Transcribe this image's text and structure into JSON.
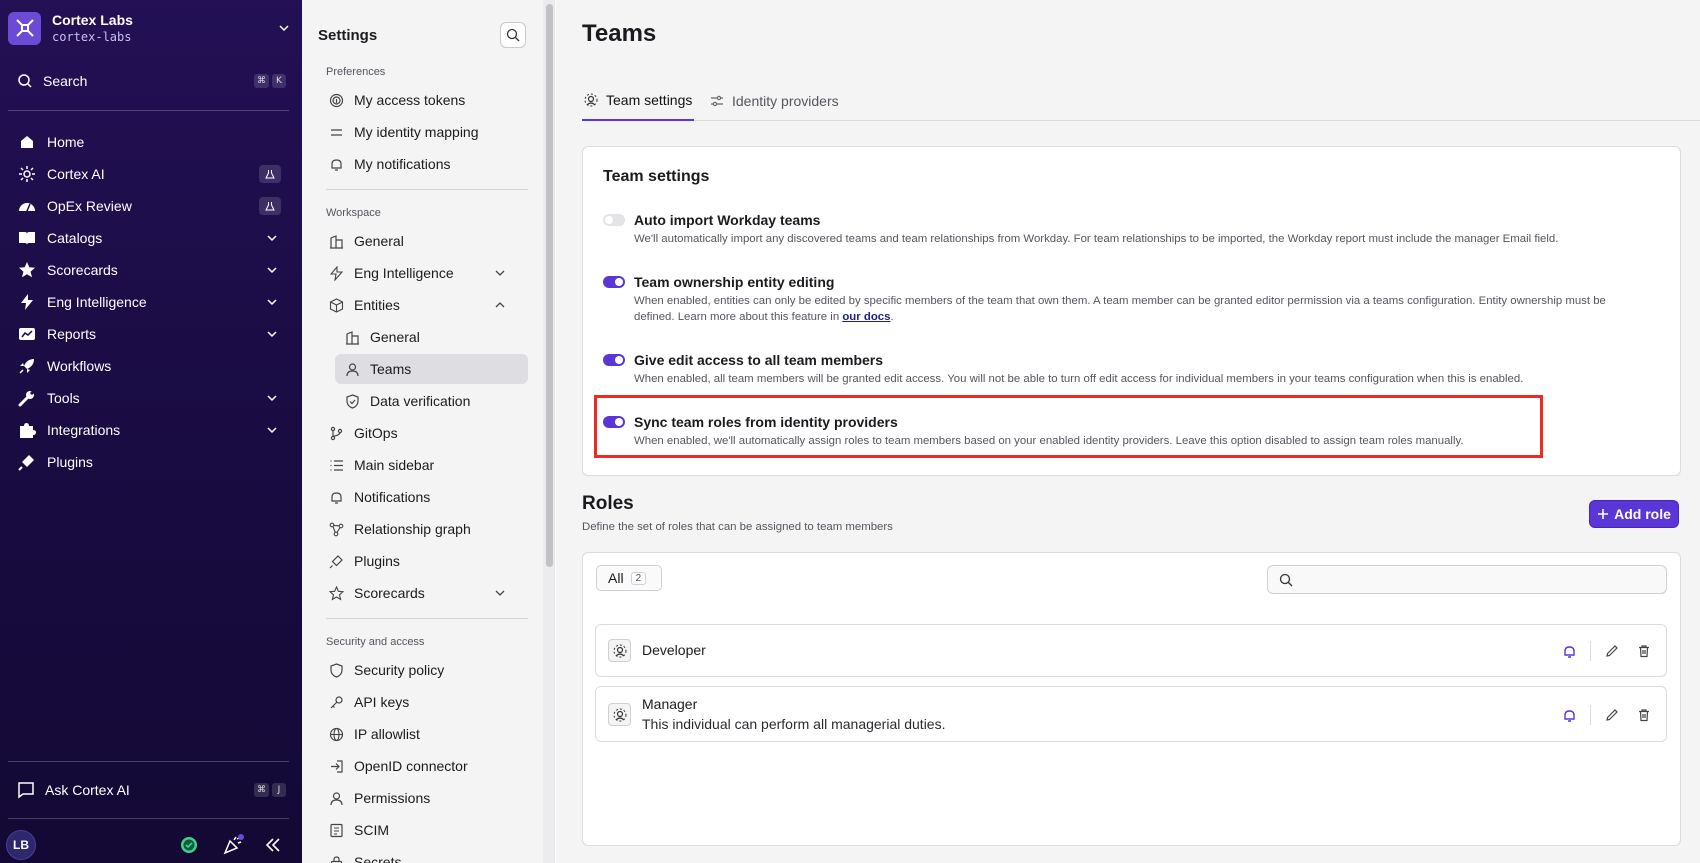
{
  "org": {
    "name": "Cortex Labs",
    "slug": "cortex-labs"
  },
  "nav": {
    "search_label": "Search",
    "search_keys": [
      "⌘",
      "K"
    ],
    "items": [
      {
        "label": "Home",
        "icon": "home-icon"
      },
      {
        "label": "Cortex AI",
        "icon": "sparkle-icon",
        "badge": "flask-icon"
      },
      {
        "label": "OpEx Review",
        "icon": "gauge-icon",
        "badge": "flask-icon"
      },
      {
        "label": "Catalogs",
        "icon": "book-icon",
        "chevron": true
      },
      {
        "label": "Scorecards",
        "icon": "star-icon",
        "chevron": true
      },
      {
        "label": "Eng Intelligence",
        "icon": "bolt-icon",
        "chevron": true
      },
      {
        "label": "Reports",
        "icon": "chart-icon",
        "chevron": true
      },
      {
        "label": "Workflows",
        "icon": "rocket-icon"
      },
      {
        "label": "Tools",
        "icon": "wrench-icon",
        "chevron": true
      },
      {
        "label": "Integrations",
        "icon": "puzzle-icon",
        "chevron": true
      },
      {
        "label": "Plugins",
        "icon": "plug-icon"
      }
    ],
    "ask_label": "Ask Cortex AI",
    "ask_keys": [
      "⌘",
      "J"
    ],
    "avatar_initials": "LB"
  },
  "settings": {
    "title": "Settings",
    "groups": {
      "preferences": "Preferences",
      "workspace": "Workspace",
      "security": "Security and access"
    },
    "preferences_items": [
      "My access tokens",
      "My identity mapping",
      "My notifications"
    ],
    "workspace_items": {
      "general": "General",
      "eng_intelligence": "Eng Intelligence",
      "entities": "Entities",
      "entities_general": "General",
      "teams": "Teams",
      "data_verification": "Data verification",
      "gitops": "GitOps",
      "main_sidebar": "Main sidebar",
      "notifications": "Notifications",
      "relationship_graph": "Relationship graph",
      "plugins": "Plugins",
      "scorecards": "Scorecards"
    },
    "security_items": [
      "Security policy",
      "API keys",
      "IP allowlist",
      "OpenID connector",
      "Permissions",
      "SCIM",
      "Secrets"
    ]
  },
  "page": {
    "title": "Teams",
    "tabs": {
      "team_settings": "Team settings",
      "identity_providers": "Identity providers"
    },
    "card_title": "Team settings",
    "settings": [
      {
        "title": "Auto import Workday teams",
        "on": false,
        "desc": "We'll automatically import any discovered teams and team relationships from Workday. For team relationships to be imported, the Workday report must include the manager Email field."
      },
      {
        "title": "Team ownership entity editing",
        "on": true,
        "desc": "When enabled, entities can only be edited by specific members of the team that own them. A team member can be granted editor permission via a teams configuration. Entity ownership must be defined. Learn more about this feature in ",
        "link": "our docs",
        "desc_end": "."
      },
      {
        "title": "Give edit access to all team members",
        "on": true,
        "desc": "When enabled, all team members will be granted edit access. You will not be able to turn off edit access for individual members in your teams configuration when this is enabled."
      },
      {
        "title": "Sync team roles from identity providers",
        "on": true,
        "desc": "When enabled, we'll automatically assign roles to team members based on your enabled identity providers. Leave this option disabled to assign team roles manually."
      }
    ],
    "roles": {
      "title": "Roles",
      "subtitle": "Define the set of roles that can be assigned to team members",
      "add_label": "Add role",
      "filter_label": "All",
      "filter_count": "2",
      "search_placeholder": "",
      "items": [
        {
          "name": "Developer",
          "desc": ""
        },
        {
          "name": "Manager",
          "desc": "This individual can perform all managerial duties."
        }
      ]
    }
  }
}
